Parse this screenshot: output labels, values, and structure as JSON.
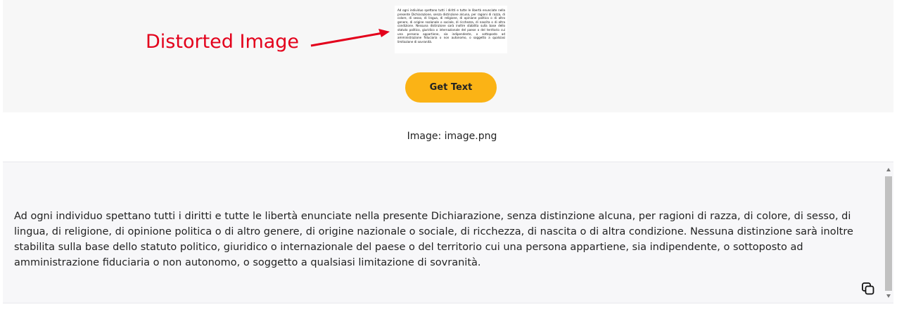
{
  "annotation": {
    "label": "Distorted Image",
    "color": "#e3001b",
    "icon": "arrow-right-icon"
  },
  "thumbnail": {
    "text": "Ad ogni individuo spettano tutti i diritti e tutte le libertà enunciate nella presente Dichiarazione, senza distinzione alcuna, per ragioni di razza, di colore, di sesso, di lingua, di religione, di opinione politica o di altro genere, di origine nazionale o sociale, di ricchezza, di nascita o di altra condizione. Nessuna distinzione sarà inoltre stabilita sulla base dello statuto politico, giuridico o internazionale del paese o del territorio cui una persona appartiene, sia indipendente, o sottoposto ad amministrazione fiduciaria o non autonomo, o soggetto a qualsiasi limitazione di sovranità."
  },
  "actions": {
    "get_text_label": "Get Text",
    "accent_color": "#fbb315"
  },
  "caption": "Image: image.png",
  "result": {
    "text": "Ad ogni individuo spettano tutti i diritti e tutte le libertà enunciate nella presente Dichiarazione, senza distinzione alcuna, per ragioni di razza, di colore, di sesso, di lingua, di religione, di opinione politica o di altro genere, di origine nazionale o sociale, di ricchezza, di nascita o di altra condizione. Nessuna distinzione sarà inoltre stabilita sulla base dello statuto politico, giuridico o internazionale del paese o del territorio cui una persona appartiene, sia indipendente, o sottoposto ad amministrazione fiduciaria o non autonomo, o soggetto a qualsiasi limitazione di sovranità.",
    "copy_icon": "copy-icon"
  }
}
